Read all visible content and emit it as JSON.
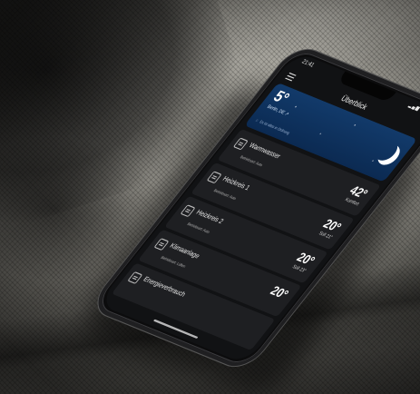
{
  "status_bar": {
    "time": "21:41",
    "signal": "▂▄▆ ◔ ▭"
  },
  "appbar": {
    "title": "Überblick"
  },
  "weather": {
    "temperature": "5°",
    "location": "Berlin, DE ↗",
    "hint": "Es ist alles in Ordnung"
  },
  "rows": [
    {
      "title": "Warmwasser",
      "sub": "Betriebsart: Auto",
      "value": "42°",
      "soll": "Komfort",
      "icon": "water-heater-icon"
    },
    {
      "title": "Heizkreis 1",
      "sub": "Betriebsart: Auto",
      "value": "20°",
      "soll": "Soll 21°",
      "icon": "radiator-icon"
    },
    {
      "title": "Heizkreis 2",
      "sub": "Betriebsart: Auto",
      "value": "20°",
      "soll": "Soll 23°",
      "icon": "radiator-icon"
    },
    {
      "title": "Klimaanlage",
      "sub": "Betriebsart: Lüften",
      "value": "20°",
      "soll": "",
      "icon": "air-conditioner-icon"
    },
    {
      "title": "Energieverbrauch",
      "sub": "",
      "value": "",
      "soll": "",
      "icon": "energy-meter-icon"
    }
  ]
}
